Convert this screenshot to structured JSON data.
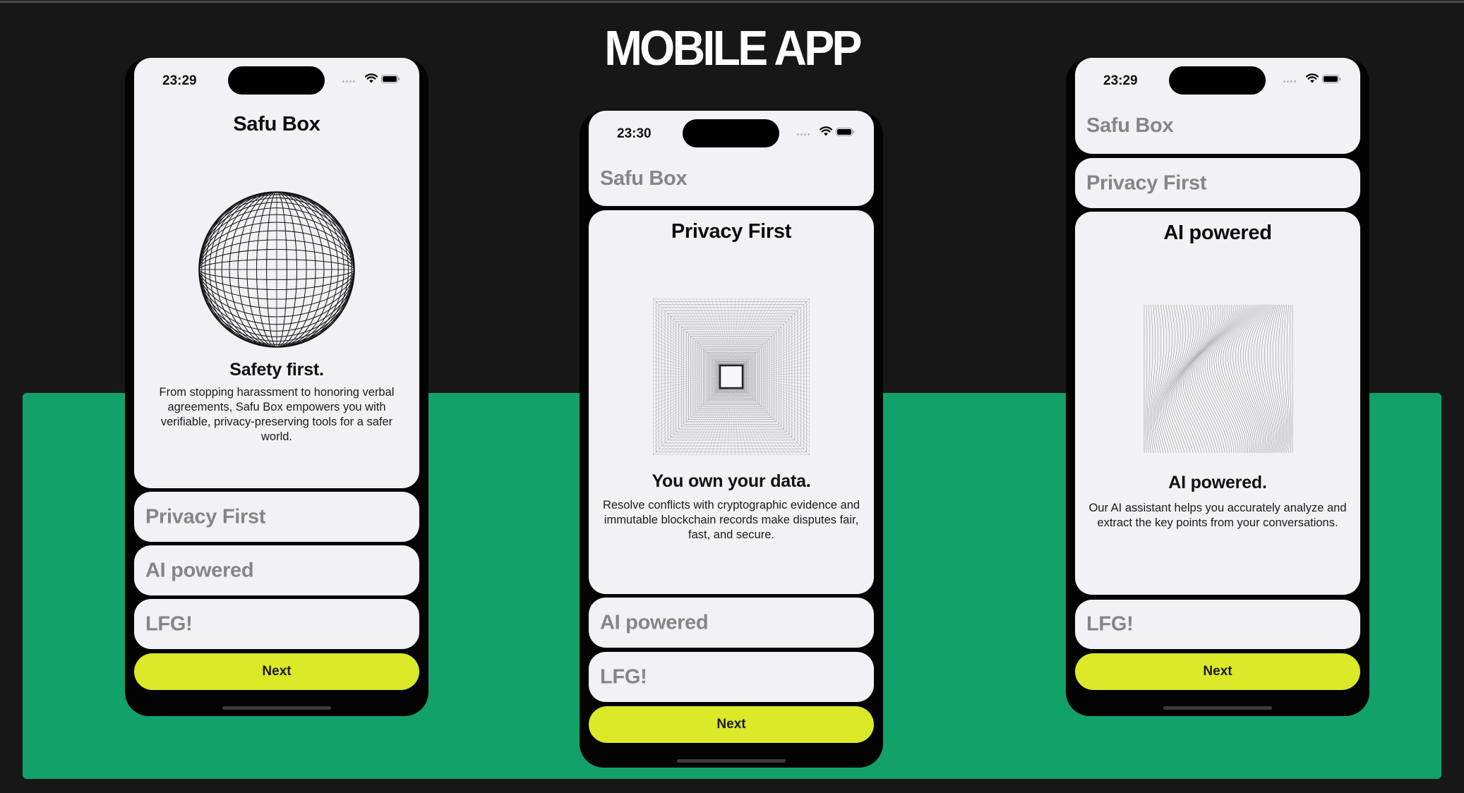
{
  "page": {
    "title": "MOBILE APP",
    "colors": {
      "background": "#171717",
      "band": "#12a16a",
      "accent_button": "#dbe928",
      "card": "#f2f2f6",
      "muted_text": "#85858a"
    }
  },
  "phones": [
    {
      "status": {
        "time": "23:29"
      },
      "header": "Safu Box",
      "active_section": {
        "title": "Safu Box",
        "illustration": "wireframe-sphere",
        "headline": "Safety first.",
        "body": "From stopping harassment to honoring verbal agreements, Safu Box empowers you with verifiable, privacy-preserving tools for a safer world."
      },
      "collapsed_sections": [
        "Privacy First",
        "AI powered",
        "LFG!"
      ],
      "button_label": "Next"
    },
    {
      "status": {
        "time": "23:30"
      },
      "header": "Safu Box",
      "active_section": {
        "title": "Privacy First",
        "illustration": "square-tunnel",
        "headline": "You own your data.",
        "body": "Resolve conflicts with cryptographic evidence and immutable blockchain records make disputes fair, fast, and secure."
      },
      "collapsed_sections": [
        "AI powered",
        "LFG!"
      ],
      "button_label": "Next"
    },
    {
      "status": {
        "time": "23:29"
      },
      "header": "Safu Box",
      "sections_above": [
        "Privacy First"
      ],
      "active_section": {
        "title": "AI powered",
        "illustration": "wavy-surface",
        "headline": "AI powered.",
        "body": "Our AI assistant helps you accurately analyze and extract the key points from your conversations."
      },
      "collapsed_sections": [
        "LFG!"
      ],
      "button_label": "Next"
    }
  ],
  "icons": {
    "signal": "signal-dots-icon",
    "wifi": "wifi-icon",
    "battery": "battery-icon"
  }
}
